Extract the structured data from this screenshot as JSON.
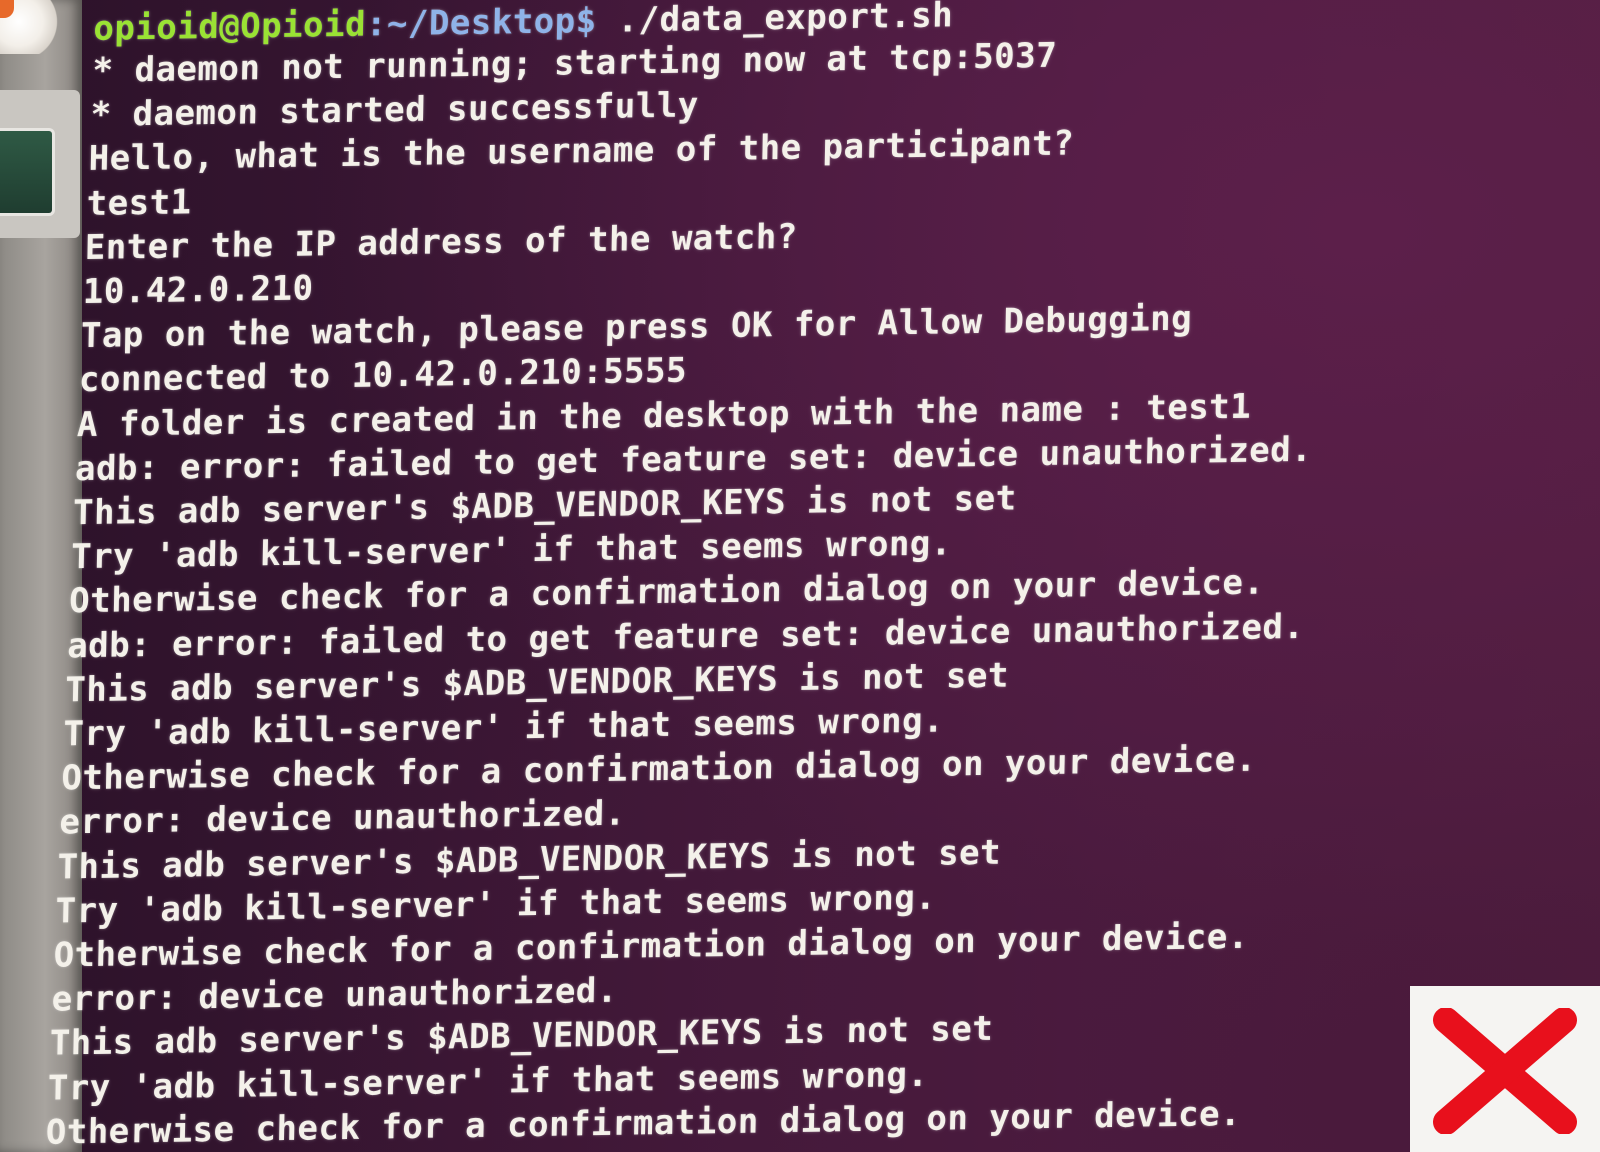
{
  "prompt": {
    "user_host": "opioid@Opioid",
    "path": ":~/Desktop",
    "symbol": "$",
    "command": " ./data_export.sh"
  },
  "output": [
    "* daemon not running; starting now at tcp:5037",
    "* daemon started successfully",
    "Hello, what is the username of the participant?",
    "test1",
    "Enter the IP address of the watch?",
    "10.42.0.210",
    "Tap on the watch, please press OK for Allow Debugging",
    "connected to 10.42.0.210:5555",
    "A folder is created in the desktop with the name : test1",
    "adb: error: failed to get feature set: device unauthorized.",
    "This adb server's $ADB_VENDOR_KEYS is not set",
    "Try 'adb kill-server' if that seems wrong.",
    "Otherwise check for a confirmation dialog on your device.",
    "adb: error: failed to get feature set: device unauthorized.",
    "This adb server's $ADB_VENDOR_KEYS is not set",
    "Try 'adb kill-server' if that seems wrong.",
    "Otherwise check for a confirmation dialog on your device.",
    "error: device unauthorized.",
    "This adb server's $ADB_VENDOR_KEYS is not set",
    "Try 'adb kill-server' if that seems wrong.",
    "Otherwise check for a confirmation dialog on your device.",
    "error: device unauthorized.",
    "This adb server's $ADB_VENDOR_KEYS is not set",
    "Try 'adb kill-server' if that seems wrong.",
    "Otherwise check for a confirmation dialog on your device."
  ],
  "colors": {
    "prompt_user": "#9ae234",
    "prompt_path": "#8fb3e8",
    "text": "#f4f1ea",
    "background": "#3a1634",
    "reject_mark": "#e8101c"
  },
  "icons": {
    "reject_mark": "close-icon",
    "dock_top": "app-icon",
    "dock_terminal": "terminal-icon"
  }
}
